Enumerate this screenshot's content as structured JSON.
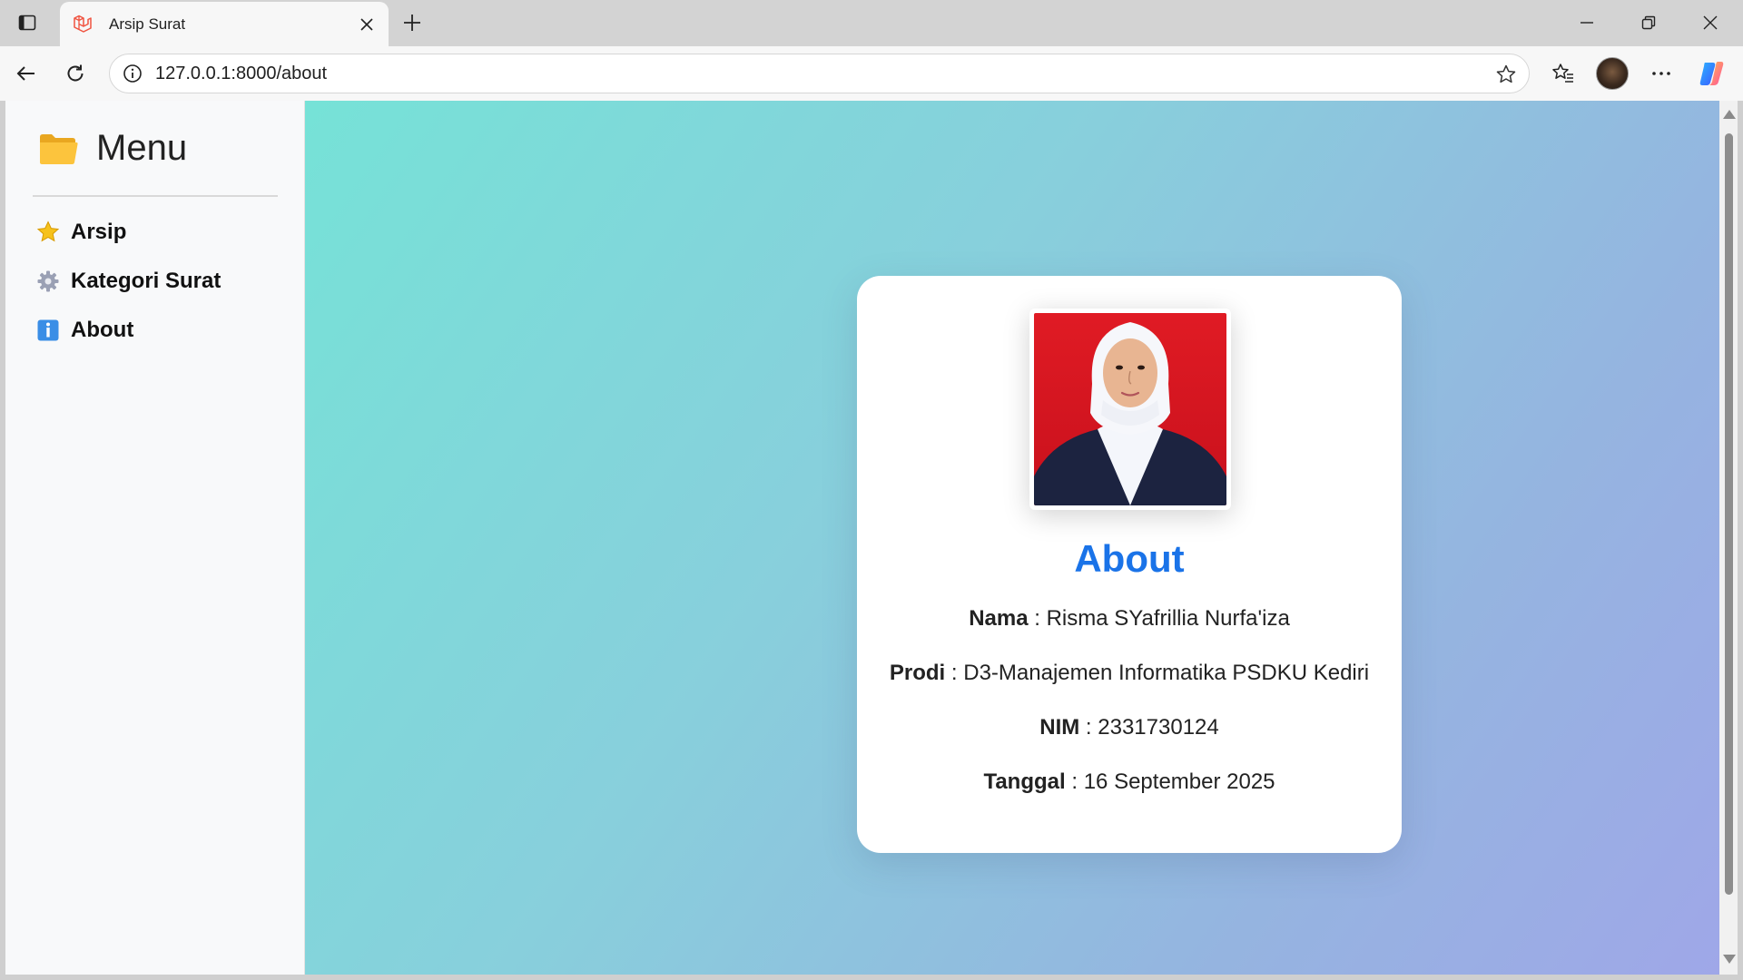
{
  "browser": {
    "tab": {
      "title": "Arsip Surat",
      "favicon": "laravel-logo-icon"
    },
    "address": {
      "url": "127.0.0.1:8000/about"
    },
    "icons": [
      "tab-actions-icon",
      "close-icon",
      "plus-icon",
      "minimize-icon",
      "restore-icon",
      "window-close-icon",
      "back-arrow-icon",
      "refresh-icon",
      "info-icon",
      "star-icon",
      "favorites-icon",
      "more-icon",
      "copilot-icon"
    ]
  },
  "sidebar": {
    "title": "Menu",
    "title_icon": "folder-icon",
    "items": [
      {
        "label": "Arsip",
        "icon": "star-icon"
      },
      {
        "label": "Kategori Surat",
        "icon": "gear-icon"
      },
      {
        "label": "About",
        "icon": "info-icon"
      }
    ]
  },
  "card": {
    "title": "About",
    "rows": [
      {
        "label": "Nama",
        "sep": " : ",
        "value": "Risma SYafrillia Nurfa'iza"
      },
      {
        "label": "Prodi",
        "sep": " : ",
        "value": "D3-Manajemen Informatika PSDKU Kediri"
      },
      {
        "label": "NIM",
        "sep": " : ",
        "value": "2331730124"
      },
      {
        "label": "Tanggal",
        "sep": " : ",
        "value": "16 September 2025"
      }
    ]
  },
  "colors": {
    "accent": "#1a73e8",
    "gradient_start": "#76e2d7",
    "gradient_end": "#9fa7e8",
    "photo_background": "#d7141f"
  }
}
